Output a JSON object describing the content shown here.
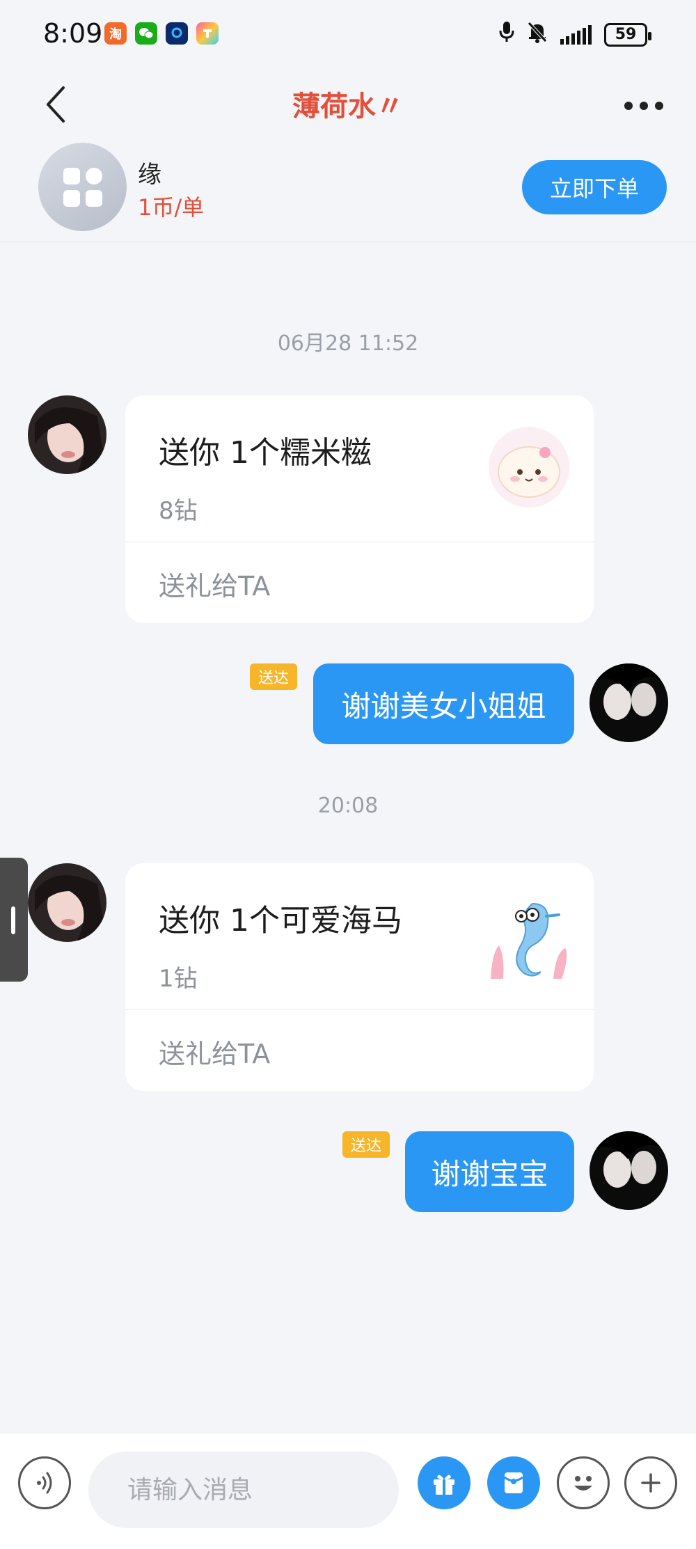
{
  "status_bar": {
    "time": "8:09",
    "battery": "59",
    "notification_icons": [
      "taobao-icon",
      "wechat-icon",
      "blue-app-icon",
      "colorful-app-icon"
    ]
  },
  "header": {
    "title": "薄荷水〃"
  },
  "service": {
    "name": "缘",
    "price": "1币/单",
    "order_button": "立即下单"
  },
  "messages": {
    "ts1": "06月28 11:52",
    "gift1": {
      "title": "送你 1个糯米糍",
      "price": "8钻",
      "action": "送礼给TA"
    },
    "reply1": {
      "badge": "送达",
      "text": "谢谢美女小姐姐"
    },
    "ts2": "20:08",
    "gift2": {
      "title": "送你 1个可爱海马",
      "price": "1钻",
      "action": "送礼给TA"
    },
    "reply2": {
      "badge": "送达",
      "text": "谢谢宝宝"
    }
  },
  "input_bar": {
    "placeholder": "请输入消息"
  },
  "colors": {
    "accent_blue": "#2a97f5",
    "title_red": "#e2503a",
    "badge_yellow": "#f7b52a",
    "background": "#f3f5f8"
  }
}
